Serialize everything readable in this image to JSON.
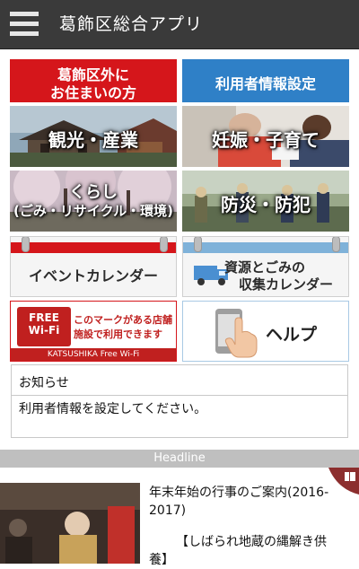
{
  "header": {
    "title": "葛飾区総合アプリ",
    "menu_icon": "hamburger-icon"
  },
  "tiles": {
    "outside": {
      "line1": "葛飾区外に",
      "line2": "お住まいの方"
    },
    "user_settings": {
      "label": "利用者情報設定"
    },
    "tourism": {
      "label": "観光・産業"
    },
    "childcare": {
      "label": "妊娠・子育て"
    },
    "living": {
      "line1": "くらし",
      "line2": "(ごみ・リサイクル・環境)"
    },
    "disaster": {
      "label": "防災・防犯"
    },
    "events": {
      "label": "イベントカレンダー"
    },
    "garbage": {
      "line1": "資源とごみの",
      "line2": "収集カレンダー"
    },
    "wifi": {
      "badge1": "FREE",
      "badge2": "Wi-Fi",
      "line1": "このマークがある店舗・",
      "line2": "施設で利用できます",
      "footer": "KATSUSHIKA Free Wi-Fi"
    },
    "help": {
      "label": "ヘルプ"
    }
  },
  "notice": {
    "title": "お知らせ",
    "text": "利用者情報を設定してください。"
  },
  "headline": {
    "label": "Headline"
  },
  "news": {
    "title": "年末年始の行事のご案内(2016-2017)",
    "subtitle": "【しばられ地蔵の縄解き供",
    "subtitle2": "養】"
  },
  "colors": {
    "header_bg": "#3a3a3a",
    "red": "#d5161b",
    "blue": "#2f80c7",
    "headline_bg": "#bfbfbf",
    "bookmark": "#8c2e2e"
  }
}
